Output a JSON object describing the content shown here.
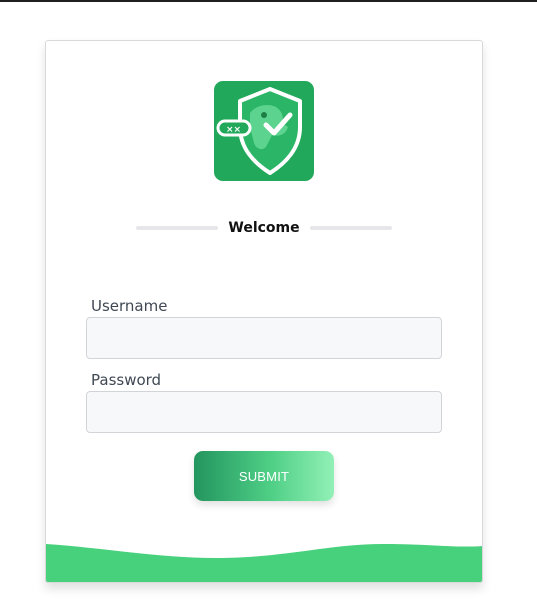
{
  "login": {
    "heading": "Welcome",
    "username_label": "Username",
    "username_value": "",
    "password_label": "Password",
    "password_value": "",
    "submit_label": "SUBMIT"
  },
  "colors": {
    "brand_green": "#22a85a",
    "wave_green": "#48d17c",
    "button_gradient_start": "#23955f",
    "button_gradient_end": "#92f0b6"
  },
  "icons": {
    "logo": "shield-check-dinosaur-icon"
  }
}
